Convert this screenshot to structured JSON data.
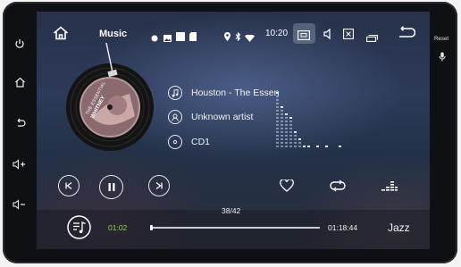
{
  "statusbar": {
    "app_title": "Music",
    "time": "10:20"
  },
  "right_panel": {
    "reset_label": "Reset"
  },
  "track": {
    "title": "Houston - The Essen",
    "artist": "Unknown artist",
    "album": "CD1"
  },
  "disc_label": {
    "line1": "THE ESSENTIAL",
    "line2": "WHITNEY"
  },
  "playback": {
    "counter": "38/42",
    "current_time": "01:02",
    "total_time": "01:18:44",
    "progress_fraction": 0.0,
    "eq_preset": "Jazz"
  },
  "colors": {
    "accent_time": "#8fd14a"
  },
  "icons": {
    "sidebar": [
      "power-icon",
      "home-icon",
      "back-icon",
      "volume-up-icon",
      "volume-down-icon"
    ],
    "statusbar": [
      "home-icon",
      "dot-icon",
      "image-icon",
      "square-icon",
      "sd-card-icon",
      "location-icon",
      "bluetooth-icon",
      "wifi-icon",
      "cast-icon",
      "volume-icon",
      "close-box-icon",
      "window-icon",
      "return-icon"
    ],
    "controls": [
      "previous-icon",
      "pause-icon",
      "next-icon",
      "heart-icon",
      "repeat-icon",
      "equalizer-icon",
      "playlist-icon"
    ]
  }
}
